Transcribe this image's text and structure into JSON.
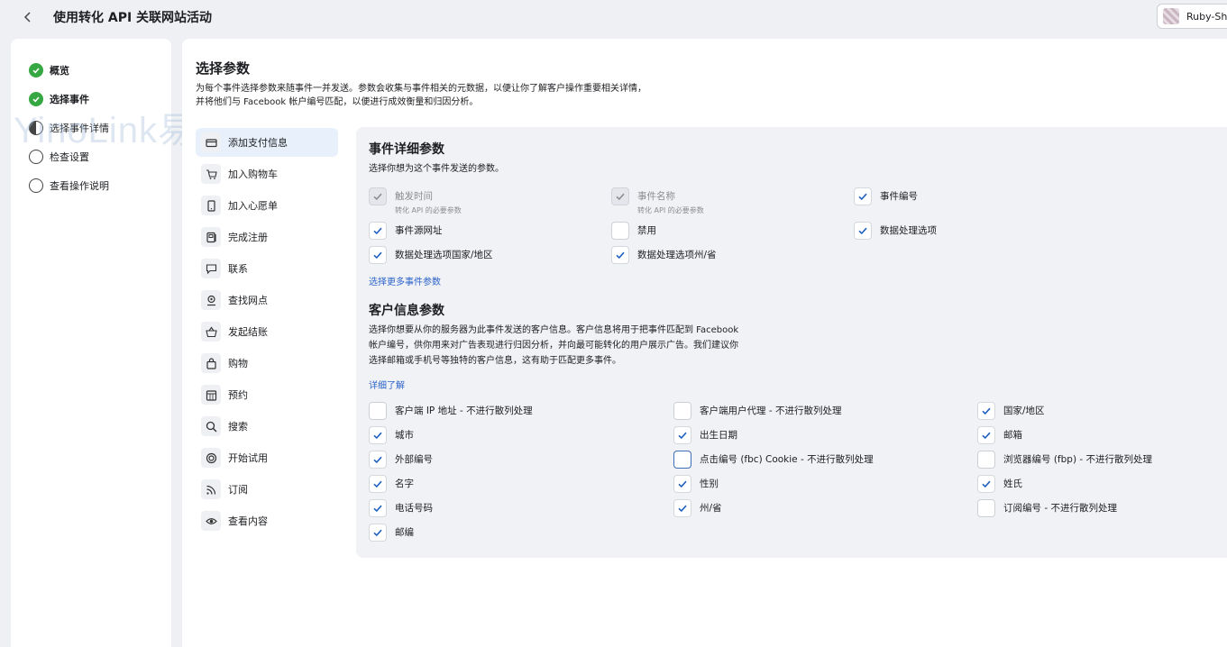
{
  "header": {
    "title": "使用转化 API 关联网站活动",
    "account_name": "Ruby-Sh"
  },
  "steps": [
    {
      "label": "概览",
      "status": "done"
    },
    {
      "label": "选择事件",
      "status": "done"
    },
    {
      "label": "选择事件详情",
      "status": "current"
    },
    {
      "label": "检查设置",
      "status": "pending"
    },
    {
      "label": "查看操作说明",
      "status": "pending"
    }
  ],
  "watermark": "YinoLink易诺",
  "main": {
    "title": "选择参数",
    "description": "为每个事件选择参数来随事件一并发送。参数会收集与事件相关的元数据，以便让你了解客户操作重要相关详情，并将他们与 Facebook 帐户编号匹配，以便进行成效衡量和归因分析。"
  },
  "events": [
    {
      "label": "添加支付信息",
      "icon": "credit-card-icon"
    },
    {
      "label": "加入购物车",
      "icon": "cart-icon"
    },
    {
      "label": "加入心愿单",
      "icon": "bookmark-icon"
    },
    {
      "label": "完成注册",
      "icon": "registration-icon"
    },
    {
      "label": "联系",
      "icon": "chat-icon"
    },
    {
      "label": "查找网点",
      "icon": "location-icon"
    },
    {
      "label": "发起结账",
      "icon": "basket-icon"
    },
    {
      "label": "购物",
      "icon": "shopping-bag-icon"
    },
    {
      "label": "预约",
      "icon": "calendar-icon"
    },
    {
      "label": "搜索",
      "icon": "search-icon"
    },
    {
      "label": "开始试用",
      "icon": "trial-icon"
    },
    {
      "label": "订阅",
      "icon": "rss-icon"
    },
    {
      "label": "查看内容",
      "icon": "eye-icon"
    }
  ],
  "event_params": {
    "title": "事件详细参数",
    "desc": "选择你想为这个事件发送的参数。",
    "more_link": "选择更多事件参数",
    "items": [
      {
        "label": "触发时间",
        "sub": "转化 API 的必要参数",
        "checked": true,
        "disabled": true
      },
      {
        "label": "事件名称",
        "sub": "转化 API 的必要参数",
        "checked": true,
        "disabled": true
      },
      {
        "label": "事件编号",
        "checked": true
      },
      {
        "label": "事件源网址",
        "checked": true
      },
      {
        "label": "禁用",
        "checked": false
      },
      {
        "label": "数据处理选项",
        "checked": true
      },
      {
        "label": "数据处理选项国家/地区",
        "checked": true
      },
      {
        "label": "数据处理选项州/省",
        "checked": true
      }
    ]
  },
  "customer_params": {
    "title": "客户信息参数",
    "desc_lines": [
      "选择你想要从你的服务器为此事件发送的客户信息。客户信息将用于把事件匹配到 Facebook",
      "帐户编号，供你用来对广告表现进行归因分析，并向最可能转化的用户展示广告。我们建议你",
      "选择邮箱或手机号等独特的客户信息，这有助于匹配更多事件。"
    ],
    "learn_more": "详细了解",
    "items": [
      {
        "label": "客户端 IP 地址 - 不进行散列处理",
        "checked": false
      },
      {
        "label": "客户端用户代理 - 不进行散列处理",
        "checked": false
      },
      {
        "label": "国家/地区",
        "checked": true
      },
      {
        "label": "城市",
        "checked": true
      },
      {
        "label": "出生日期",
        "checked": true
      },
      {
        "label": "邮箱",
        "checked": true
      },
      {
        "label": "外部编号",
        "checked": true
      },
      {
        "label": "点击编号 (fbc) Cookie - 不进行散列处理",
        "checked": false,
        "focused": true
      },
      {
        "label": "浏览器编号 (fbp) - 不进行散列处理",
        "checked": false
      },
      {
        "label": "名字",
        "checked": true
      },
      {
        "label": "性别",
        "checked": true
      },
      {
        "label": "姓氏",
        "checked": true
      },
      {
        "label": "电话号码",
        "checked": true
      },
      {
        "label": "州/省",
        "checked": true
      },
      {
        "label": "订阅编号 - 不进行散列处理",
        "checked": false
      },
      {
        "label": "邮编",
        "checked": true
      }
    ]
  },
  "colors": {
    "accent": "#2b63c9",
    "check": "#1f5fbf",
    "done": "#35a843"
  }
}
